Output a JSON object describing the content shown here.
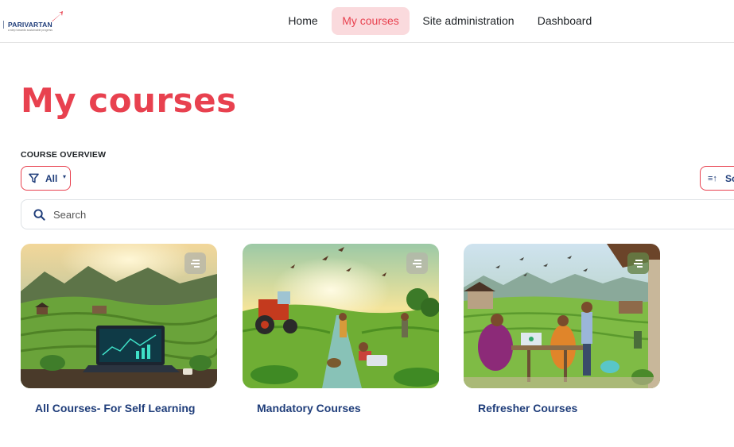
{
  "brand": {
    "name": "PARIVARTAN",
    "tagline": "a step towards sustainable progress"
  },
  "nav": {
    "items": [
      {
        "label": "Home",
        "active": false
      },
      {
        "label": "My courses",
        "active": true
      },
      {
        "label": "Site administration",
        "active": false
      },
      {
        "label": "Dashboard",
        "active": false
      }
    ]
  },
  "page": {
    "title": "My courses",
    "section_label": "COURSE OVERVIEW"
  },
  "filter": {
    "icon": "funnel-icon",
    "label": "All",
    "caret": "▾"
  },
  "sort": {
    "icon": "sort-icon",
    "glyph": "≡↑",
    "label": "Sort"
  },
  "search": {
    "placeholder": "Search",
    "value": ""
  },
  "courses": [
    {
      "title": "All Courses- For Self Learning",
      "image": "farm-laptop-terraces-image"
    },
    {
      "title": "Mandatory Courses",
      "image": "tractor-farmers-sunrise-image"
    },
    {
      "title": "Refresher Courses",
      "image": "village-women-laptop-image"
    }
  ],
  "colors": {
    "accent": "#e8414f",
    "accent_soft": "#fadadd",
    "link": "#1f3d7a",
    "border": "#dee2e6"
  }
}
